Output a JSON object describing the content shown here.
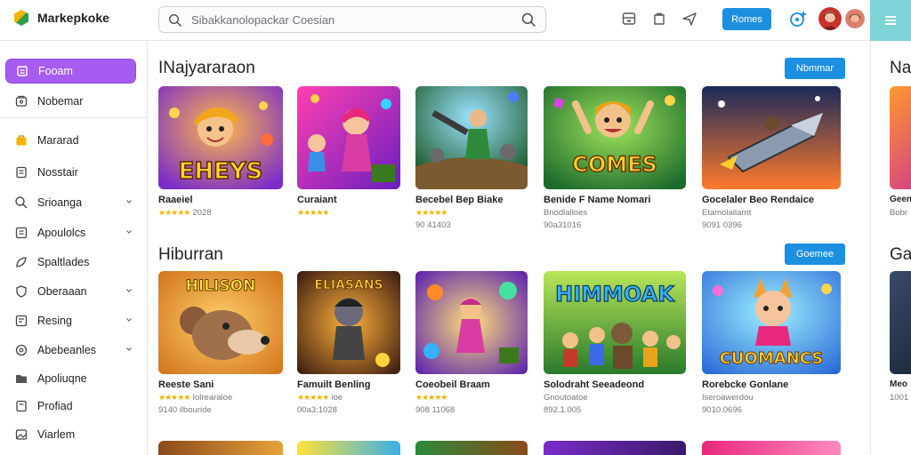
{
  "app": {
    "name": "Markepkoke"
  },
  "search": {
    "placeholder": "Sibakkanolopackar Coesian"
  },
  "toolbar": {
    "primary_label": "Romes"
  },
  "sidebar": {
    "items": [
      {
        "label": "Fooam",
        "icon": "home-icon",
        "active": true
      },
      {
        "label": "Nobemar",
        "icon": "store-icon"
      },
      {
        "label": "Mararad",
        "icon": "bag-icon"
      },
      {
        "label": "Nosstair",
        "icon": "page-icon"
      },
      {
        "label": "Srioanga",
        "icon": "search-icon",
        "chevron": true
      },
      {
        "label": "Apoulolcs",
        "icon": "apps-icon",
        "chevron": true
      },
      {
        "label": "Spaltlades",
        "icon": "leaf-icon"
      },
      {
        "label": "Oberaaan",
        "icon": "shield-icon",
        "chevron": true
      },
      {
        "label": "Resing",
        "icon": "list-icon",
        "chevron": true
      },
      {
        "label": "Abebeanles",
        "icon": "disc-icon",
        "chevron": true
      },
      {
        "label": "Apoliuqne",
        "icon": "folder-icon"
      },
      {
        "label": "Profiad",
        "icon": "doc-icon"
      },
      {
        "label": "Viarlem",
        "icon": "image-icon"
      }
    ]
  },
  "sections": [
    {
      "title": "INajyararaon",
      "button": "Nbmmar",
      "cards": [
        {
          "title": "Raaeiel",
          "sub": "2028",
          "meta": "",
          "rating": true,
          "art": "EHEYS"
        },
        {
          "title": "Curaiant",
          "sub": "",
          "meta": "",
          "rating": true,
          "art": ""
        },
        {
          "title": "Becebel Bep Biake",
          "sub": "",
          "meta": "90 41403",
          "rating": true,
          "art": ""
        },
        {
          "title": "Benide F Name Nomari",
          "sub": "Bnodlalloes",
          "meta": "90a31016",
          "rating": false,
          "art": "COMES"
        },
        {
          "title": "Gocelaler Beo Rendaice",
          "sub": "Etamolallarnt",
          "meta": "9091 0396",
          "rating": false,
          "art": ""
        }
      ]
    },
    {
      "title": "Hiburran",
      "button": "Goemee",
      "cards": [
        {
          "title": "Reeste Sani",
          "sub": "Iolrearaloe",
          "meta": "9140 ilbouride",
          "rating": true,
          "art": "HILISON"
        },
        {
          "title": "Famuilt Benling",
          "sub": "ioe",
          "meta": "00a3:1028",
          "rating": true,
          "art": "ELIASANS"
        },
        {
          "title": "Coeobeil Braam",
          "sub": "",
          "meta": "908 11068",
          "rating": true,
          "art": ""
        },
        {
          "title": "Solodraht Seeadeond",
          "sub": "Gnoutoatoe",
          "meta": "892.1.005",
          "rating": false,
          "art": "HIMMOAK"
        },
        {
          "title": "Rorebcke Gonlane",
          "sub": "Iseroawerdou",
          "meta": "9010.0696",
          "rating": false,
          "art": "CUOMANCS"
        }
      ]
    }
  ],
  "right_panel": {
    "titles": [
      "Na",
      "Gar"
    ],
    "texts": [
      "Geen",
      "Meo"
    ],
    "metas": [
      "Bobr",
      "1001"
    ]
  },
  "colors": {
    "accent": "#a75cf0",
    "primary": "#1d8fe1",
    "teal": "#7ed3d6",
    "star": "#f4b400"
  }
}
